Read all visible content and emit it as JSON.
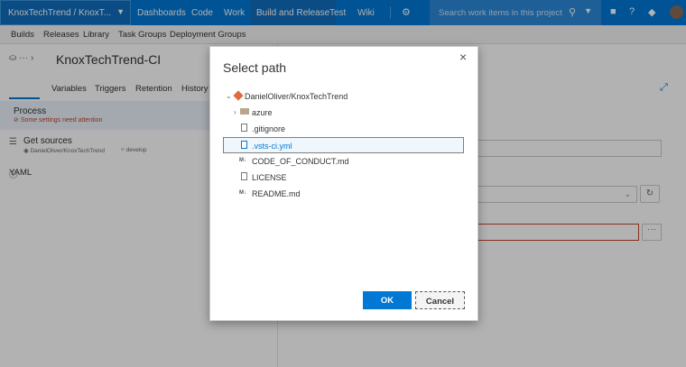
{
  "topnav": {
    "project": "KnoxTechTrend / KnoxT...",
    "items": [
      "Dashboards",
      "Code",
      "Work",
      "Build and Release",
      "Test",
      "Wiki"
    ],
    "search_placeholder": "Search work items in this project"
  },
  "subnav": {
    "items": [
      "Builds",
      "Releases",
      "Library",
      "Task Groups",
      "Deployment Groups"
    ]
  },
  "page": {
    "breadcrumb_more": "···",
    "title": "KnoxTechTrend-CI",
    "tabs": [
      "YAML",
      "Variables",
      "Triggers",
      "Retention",
      "History"
    ],
    "process": {
      "label": "Process",
      "warning": "Some settings need attention"
    },
    "get_sources": {
      "label": "Get sources",
      "repo": "DanielOliver/KnoxTechTrend",
      "branch": "develop"
    }
  },
  "dialog": {
    "title": "Select path",
    "root": "DanielOliver/KnoxTechTrend",
    "entries": [
      {
        "name": "azure",
        "type": "folder"
      },
      {
        "name": ".gitignore",
        "type": "file"
      },
      {
        "name": ".vsts-ci.yml",
        "type": "file",
        "selected": true
      },
      {
        "name": "CODE_OF_CONDUCT.md",
        "type": "markdown"
      },
      {
        "name": "LICENSE",
        "type": "file"
      },
      {
        "name": "README.md",
        "type": "markdown"
      }
    ],
    "ok_label": "OK",
    "cancel_label": "Cancel",
    "md_badge": "M↓"
  },
  "colors": {
    "accent": "#0078d4",
    "warning": "#c4442c",
    "error_border": "#c4442c"
  }
}
